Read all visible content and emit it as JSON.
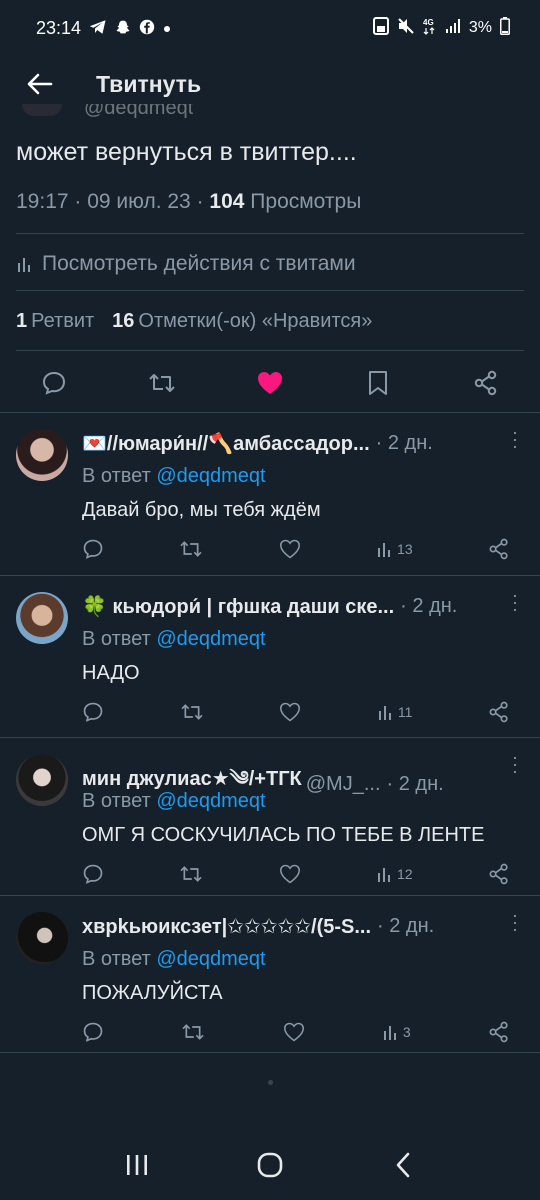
{
  "status_bar": {
    "time": "23:14",
    "left_icons": [
      "telegram-icon",
      "snapchat-icon",
      "facebook-icon",
      "dot-icon"
    ],
    "right_icons": [
      "save-icon",
      "mute-icon",
      "4g-icon",
      "signal-icon"
    ],
    "battery": "3%"
  },
  "header": {
    "title": "Твитнуть"
  },
  "tweet": {
    "clipped_handle": "@deqdmeqt",
    "text": "может вернуться в твиттер....",
    "time": "19:17",
    "date": "09 июл. 23",
    "views_count": "104",
    "views_label": "Просмотры",
    "analytics_label": "Посмотреть действия с твитами",
    "retweets_count": "1",
    "retweets_label": "Ретвит",
    "likes_count": "16",
    "likes_label": "Отметки(-ок) «Нравится»"
  },
  "replies": [
    {
      "name": "💌//юмари́н//🪓амбассадор...",
      "handle": "",
      "time": "2 дн.",
      "reply_prefix": "В ответ",
      "mention": "@deqdmeqt",
      "text": "Давай бро, мы тебя ждём",
      "views": "13"
    },
    {
      "name": "🍀 кьюдори́ | гфшка даши ске...",
      "handle": "",
      "time": "2 дн.",
      "reply_prefix": "В ответ",
      "mention": "@deqdmeqt",
      "text": "НАДО",
      "views": "11"
    },
    {
      "name": "мин джулиас★༄/+ТГК",
      "handle": "@MJ_...",
      "time": "2 дн.",
      "reply_prefix": "В ответ",
      "mention": "@deqdmeqt",
      "text": "ОМГ Я СОСКУЧИЛАСЬ ПО ТЕБЕ В ЛЕНТЕ",
      "views": "12"
    },
    {
      "name": "хврkьюиксзет|✩✩✩✩✩/(5-S...",
      "handle": "",
      "time": "2 дн.",
      "reply_prefix": "В ответ",
      "mention": "@deqdmeqt",
      "text": "ПОЖАЛУЙСТА",
      "views": "3"
    }
  ],
  "colors": {
    "background": "#15202b",
    "accent": "#1d9bf0",
    "like": "#f91880",
    "muted": "#8b98a5",
    "divider": "#38444d"
  }
}
